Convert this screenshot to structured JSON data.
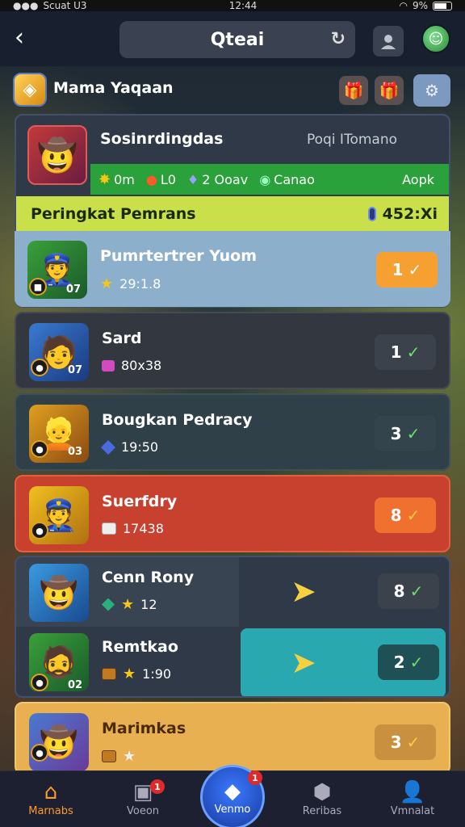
{
  "status_bar": {
    "carrier": "Scuat U3",
    "time": "12:44",
    "battery": "9%"
  },
  "header": {
    "back_icon": "back-arrow-icon",
    "title": "Qteai",
    "refresh_icon": "refresh-icon"
  },
  "sub_header": {
    "title": "Mama Yaqaan"
  },
  "me": {
    "name": "Sosinrdingdas",
    "subtitle": "Poqi ITomano",
    "stats": {
      "coins": "0m",
      "lives": "L0",
      "potions": "2 Ooav",
      "cash": "Canao",
      "apply": "Aopk"
    },
    "banner_title": "Peringkat Pemrans",
    "banner_score": "452:Xi"
  },
  "rows": [
    {
      "name": "Pumrtertrer Yuom",
      "meta": "29:1.8",
      "rank": "1",
      "badge_num": "07"
    },
    {
      "name": "Sard",
      "meta": "80x38",
      "rank": "1",
      "badge_num": "07"
    },
    {
      "name": "Bougkan Pedracy",
      "meta": "19:50",
      "rank": "3",
      "badge_num": "03"
    },
    {
      "name": "Suerfdry",
      "meta": "17438",
      "rank": "8",
      "badge_num": ""
    },
    {
      "name": "Cenn Rony",
      "meta": "12",
      "rank": "8",
      "badge_num": ""
    },
    {
      "name": "Remtkao",
      "meta": "1:90",
      "rank": "2",
      "badge_num": "02"
    },
    {
      "name": "Marimkas",
      "meta": "",
      "rank": "3",
      "badge_num": ""
    }
  ],
  "nav": {
    "items": [
      {
        "label": "Marnabs",
        "icon": "home-icon"
      },
      {
        "label": "Voeon",
        "icon": "shop-icon",
        "badge": "1"
      },
      {
        "label": "Venmo",
        "icon": "play-icon",
        "badge": "1"
      },
      {
        "label": "Reribas",
        "icon": "gem-icon"
      },
      {
        "label": "Vmnalat",
        "icon": "profile-icon"
      }
    ]
  }
}
